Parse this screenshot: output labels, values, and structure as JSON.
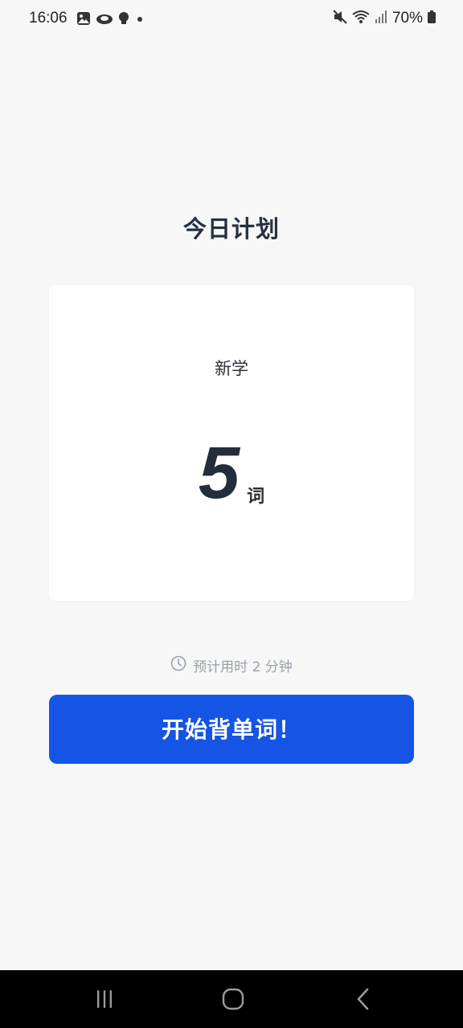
{
  "status_bar": {
    "time": "16:06",
    "battery": "70%",
    "left_icons": [
      "image-icon",
      "cloud-app-icon",
      "bulb-icon",
      "dot-icon"
    ],
    "right_icons": [
      "mute-icon",
      "wifi-icon",
      "signal-icon",
      "battery-icon"
    ]
  },
  "page": {
    "title": "今日计划"
  },
  "plan_card": {
    "label": "新学",
    "count": "5",
    "unit": "词"
  },
  "estimate": {
    "text": "预计用时 2 分钟",
    "icon": "clock-icon"
  },
  "start_button": {
    "label": "开始背单词！"
  },
  "nav_bar": {
    "icons": [
      "recent-apps-icon",
      "home-icon",
      "back-icon"
    ]
  },
  "colors": {
    "background": "#f7f7f7",
    "primary": "#1554e4",
    "title": "#26303f",
    "muted": "#9aa0aa",
    "card": "#ffffff"
  }
}
